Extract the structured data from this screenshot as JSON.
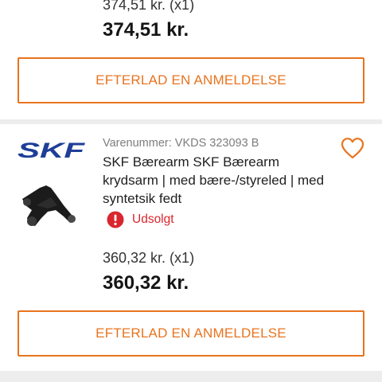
{
  "items": [
    {
      "unit_price_text": "374,51 kr. (x1)",
      "total_price": "374,51 kr.",
      "review_button_label": "EFTERLAD EN ANMELDELSE"
    },
    {
      "brand_logo_text": "SKF",
      "sku_text": "Varenummer: VKDS 323093 B",
      "title": "SKF Bærearm SKF Bærearm krydsarm | med bære-/styreled | med syntetsik fedt",
      "status_text": "Udsolgt",
      "unit_price_text": "360,32 kr. (x1)",
      "total_price": "360,32 kr.",
      "review_button_label": "EFTERLAD EN ANMELDELSE"
    }
  ],
  "colors": {
    "accent": "#e8741f",
    "brand_blue": "#1e3e97",
    "status_red": "#d9262e"
  },
  "icons": {
    "wishlist": "heart-outline-icon",
    "status": "exclamation-circle-icon"
  }
}
